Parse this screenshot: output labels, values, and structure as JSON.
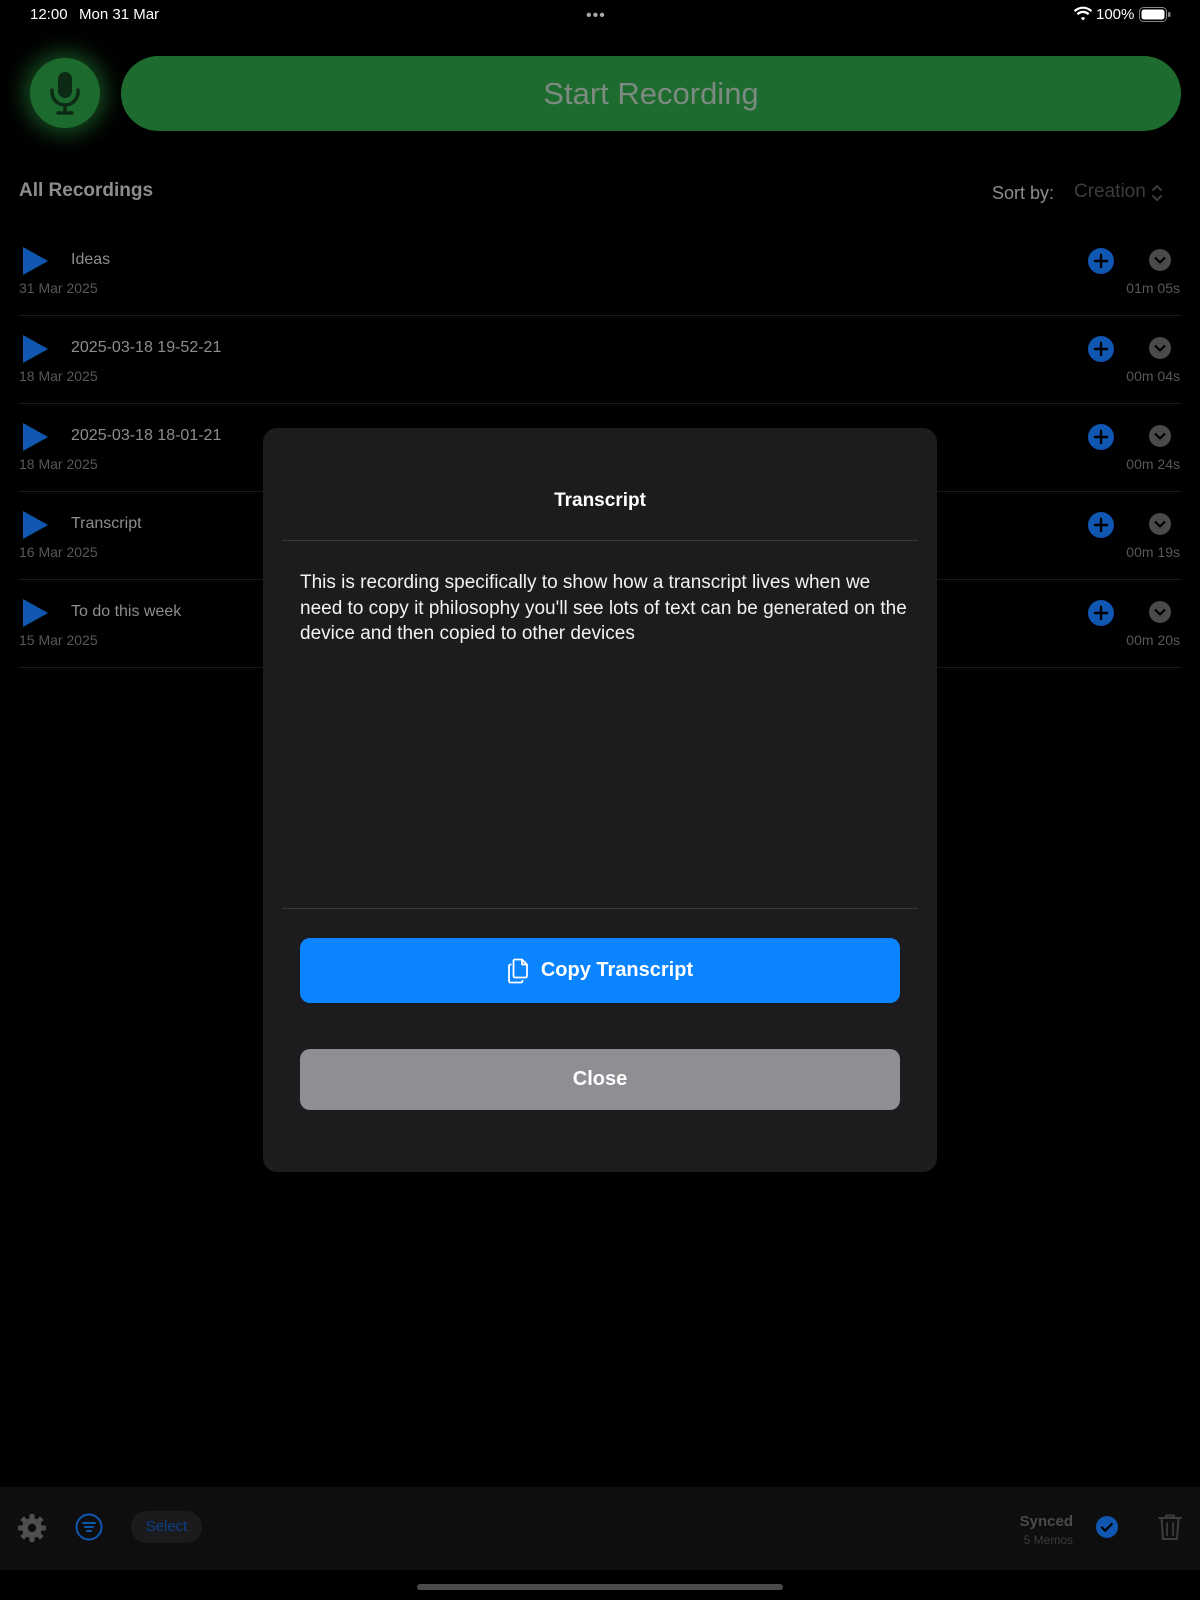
{
  "status_bar": {
    "time": "12:00",
    "date": "Mon 31 Mar",
    "battery": "100%"
  },
  "header": {
    "record_label": "Start Recording"
  },
  "list_header": {
    "title": "All Recordings",
    "sort_label": "Sort by:",
    "sort_value": "Creation"
  },
  "recordings": [
    {
      "title": "Ideas",
      "date": "31 Mar 2025",
      "duration": "01m 05s"
    },
    {
      "title": "2025-03-18 19-52-21",
      "date": "18 Mar 2025",
      "duration": "00m 04s"
    },
    {
      "title": "2025-03-18 18-01-21",
      "date": "18 Mar 2025",
      "duration": "00m 24s"
    },
    {
      "title": "Transcript",
      "date": "16 Mar 2025",
      "duration": "00m 19s"
    },
    {
      "title": "To do this week",
      "date": "15 Mar 2025",
      "duration": "00m 20s"
    }
  ],
  "modal": {
    "title": "Transcript",
    "body": "This is recording specifically to show how a transcript lives when we need to copy it philosophy you'll see lots of text can be generated on the device and then copied to other devices",
    "copy_label": "Copy Transcript",
    "close_label": "Close"
  },
  "bottom_bar": {
    "select_label": "Select",
    "sync_title": "Synced",
    "sync_subtitle": "5 Memos"
  },
  "colors": {
    "accent_green": "#1d6b2f",
    "accent_blue": "#0a84ff",
    "list_icon_blue": "#0f57b0",
    "modal_bg": "#1c1c1e",
    "close_gray": "#8e8e93"
  },
  "icons": {
    "mic": "microphone-icon",
    "play": "play-icon",
    "add": "plus-circle-icon",
    "expand": "chevron-down-circle-icon",
    "copy": "copy-document-icon",
    "settings": "gear-icon",
    "filter": "filter-icon",
    "synced": "checkmark-circle-icon",
    "trash": "trash-icon"
  }
}
